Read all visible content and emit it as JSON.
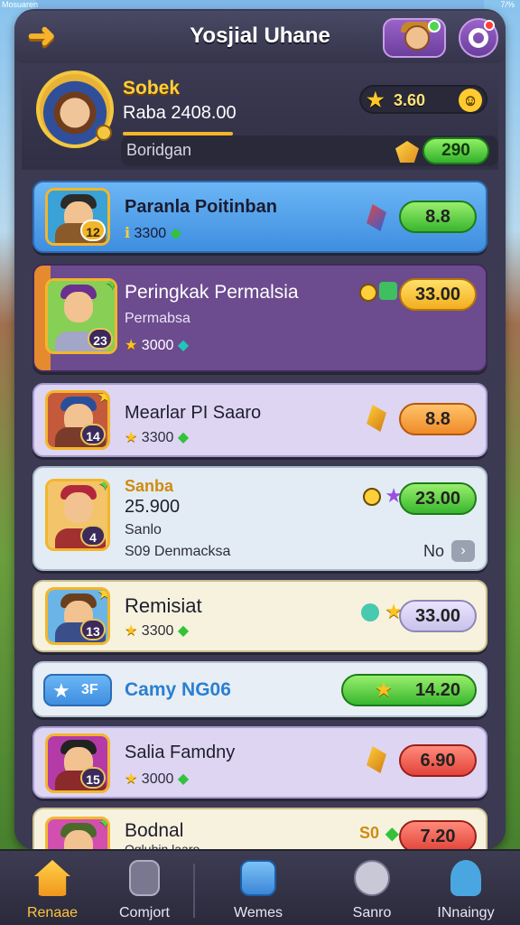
{
  "status_bar": {
    "left": "Mosuaren",
    "right": "7/%"
  },
  "header": {
    "title": "Yosjial Uhane"
  },
  "profile": {
    "name": "Sobek",
    "score": "Raba 2408.00",
    "sub_label": "Boridgan",
    "coins": "3.60",
    "gems": "290"
  },
  "rows": [
    {
      "name": "Paranla Poitinban",
      "sub": "3300",
      "level": "12",
      "button": "8.8"
    },
    {
      "name": "Peringkak Permalsia",
      "sub2": "Permabsa",
      "sub": "3000",
      "level": "23",
      "button": "33.00"
    },
    {
      "name": "Mearlar PI Saaro",
      "sub": "3300",
      "level": "14",
      "button": "8.8"
    },
    {
      "name": "Sanba",
      "name2": "25.900",
      "sub2": "Sanlo",
      "sub3": "S09 Denmacksa",
      "aside": "No",
      "level": "4",
      "button": "23.00"
    },
    {
      "name": "Remisiat",
      "sub": "3300",
      "level": "13",
      "button": "33.00"
    },
    {
      "name": "Camy NG06",
      "tag": "3F",
      "button": "14.20"
    },
    {
      "name": "Salia Famdny",
      "sub": "3000",
      "level": "15",
      "button": "6.90"
    },
    {
      "name": "Bodnal",
      "sub2": "Oglubin laaro",
      "coin_text": "S0",
      "button": "7.20"
    }
  ],
  "nav": [
    {
      "label": "Renaae",
      "icon": "home-icon"
    },
    {
      "label": "Comjort",
      "icon": "clipboard-icon"
    },
    {
      "label": "Wemes",
      "icon": "list-icon"
    },
    {
      "label": "Sanro",
      "icon": "dial-icon"
    },
    {
      "label": "INnaingy",
      "icon": "person-icon"
    }
  ],
  "colors": {
    "accent": "#f5b42b",
    "panel": "#3b3a52",
    "row_blue": "#5aa9f0",
    "row_purple": "#6b4a8c",
    "row_lilac": "#d9d1f0",
    "row_cream": "#f5f0de"
  }
}
